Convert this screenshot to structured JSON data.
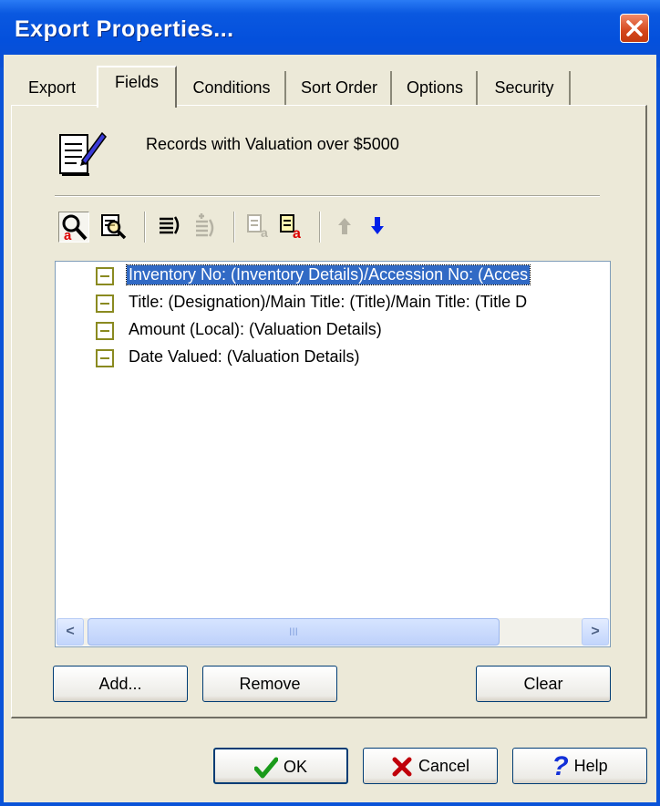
{
  "window": {
    "title": "Export Properties..."
  },
  "tabs": [
    {
      "label": "Export"
    },
    {
      "label": "Fields"
    },
    {
      "label": "Conditions"
    },
    {
      "label": "Sort Order"
    },
    {
      "label": "Options"
    },
    {
      "label": "Security"
    }
  ],
  "active_tab": "Fields",
  "header": {
    "text": "Records with Valuation over $5000",
    "icon": "notepad-pen-icon"
  },
  "toolbar": {
    "buttons": [
      {
        "icon": "field-find-icon",
        "state": "pressed"
      },
      {
        "icon": "field-browse-icon",
        "state": "normal"
      },
      {
        "icon": "list-indent-icon",
        "state": "normal"
      },
      {
        "icon": "list-outdent-icon",
        "state": "disabled"
      },
      {
        "icon": "field-rename-icon",
        "state": "disabled"
      },
      {
        "icon": "field-label-icon",
        "state": "normal"
      },
      {
        "icon": "move-up-icon",
        "state": "disabled"
      },
      {
        "icon": "move-down-icon",
        "state": "normal"
      }
    ]
  },
  "fields": [
    {
      "label": "Inventory No: (Inventory Details)/Accession No: (Acces",
      "selected": true
    },
    {
      "label": "Title: (Designation)/Main Title: (Title)/Main Title: (Title D",
      "selected": false
    },
    {
      "label": "Amount (Local): (Valuation Details)",
      "selected": false
    },
    {
      "label": "Date Valued: (Valuation Details)",
      "selected": false
    }
  ],
  "scrollbar": {
    "thumb_grip": "III"
  },
  "panel_buttons": {
    "add": "Add...",
    "remove": "Remove",
    "clear": "Clear"
  },
  "dialog_buttons": {
    "ok": "OK",
    "cancel": "Cancel",
    "help": "Help"
  },
  "colors": {
    "titlebar": "#0450dc",
    "selection": "#316ac5",
    "dialog_bg": "#ece9d8"
  }
}
